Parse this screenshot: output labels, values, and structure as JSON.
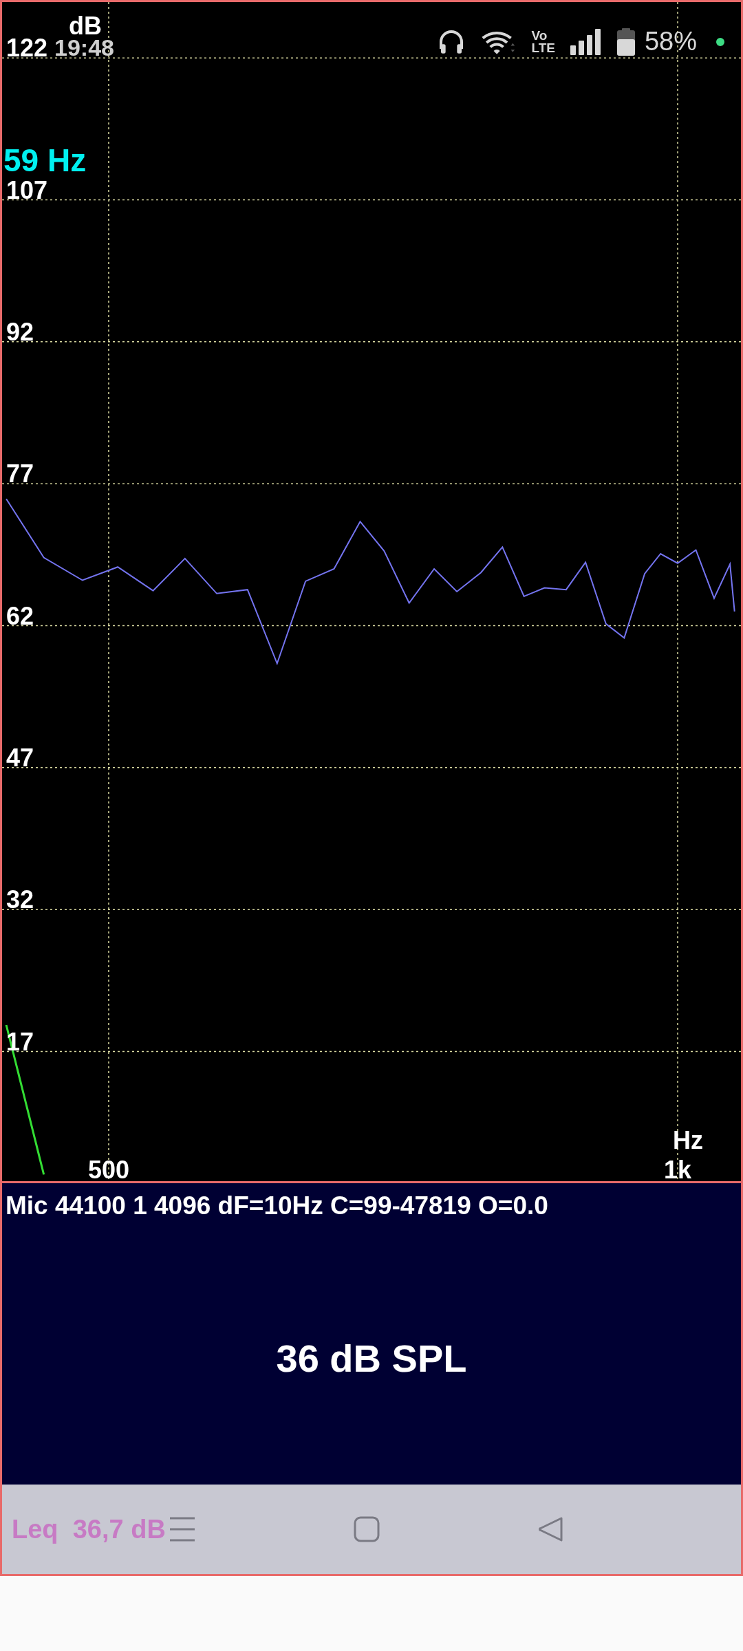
{
  "status_bar": {
    "time": "19:48",
    "network_label": [
      "Vo",
      "LTE"
    ],
    "battery_percent": "58%"
  },
  "spectrum": {
    "peak_readout": "59 Hz",
    "chart_data": {
      "type": "line",
      "xlabel": "Hz",
      "ylabel": "dB",
      "x": [
        410,
        443,
        477,
        508,
        539,
        567,
        595,
        622,
        648,
        673,
        698,
        721,
        742,
        764,
        786,
        806,
        827,
        846,
        865,
        883,
        902,
        919,
        937,
        953,
        971,
        985,
        1000,
        1016,
        1032,
        1046,
        1050
      ],
      "series": [
        {
          "color": "#7474f0",
          "values": [
            75.4,
            69.2,
            66.8,
            68.2,
            65.7,
            69.1,
            65.4,
            65.8,
            58.0,
            66.7,
            68.0,
            73.0,
            69.9,
            64.4,
            68.0,
            65.6,
            67.6,
            70.3,
            65.1,
            66.0,
            65.8,
            68.7,
            62.2,
            60.7,
            67.5,
            69.6,
            68.6,
            70.0,
            64.9,
            68.5,
            63.5
          ]
        },
        {
          "color": "#33dd33",
          "values": [
            19.8,
            4.0,
            null,
            null,
            null,
            null,
            null,
            null,
            null,
            null,
            null,
            null,
            null,
            null,
            null,
            null,
            null,
            null,
            null,
            null,
            null,
            null,
            null,
            null,
            null,
            null,
            null,
            null,
            null,
            null,
            null
          ]
        }
      ],
      "xlim": [
        406.3,
        1055.6
      ],
      "ylim": [
        3.3,
        127.9
      ],
      "grid": true,
      "xticks": [
        {
          "value": 500,
          "label": "500"
        },
        {
          "value": 1000,
          "label": "1k"
        }
      ],
      "yticks": [
        122,
        107,
        92,
        77,
        62,
        47,
        32,
        17
      ]
    }
  },
  "info": {
    "parameters": "Mic 44100 1 4096 dF=10Hz C=99-47819 O=0.0",
    "spl_reading": "36 dB SPL"
  },
  "footer": {
    "leq_label": "Leq",
    "leq_value": "36,7 dB"
  }
}
